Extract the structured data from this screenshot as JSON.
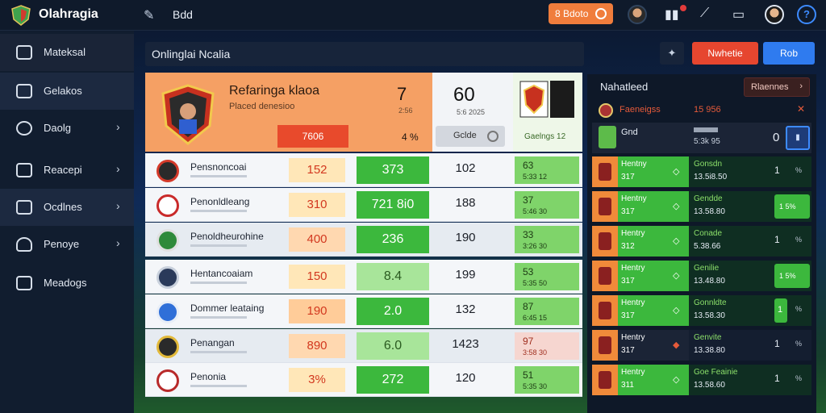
{
  "topbar": {
    "app_title": "Olahragia",
    "title2": "Bdd",
    "orange_button": "8 Bdoto"
  },
  "sidebar": {
    "items": [
      {
        "label": "Mateksal"
      },
      {
        "label": "Gelakos"
      },
      {
        "label": "Daolg"
      },
      {
        "label": "Reacepi"
      },
      {
        "label": "Ocdlnes"
      },
      {
        "label": "Penoye"
      },
      {
        "label": "Meadogs"
      }
    ]
  },
  "main": {
    "header_title": "Onlinglai Ncalia",
    "red_button": "Nwhetie",
    "blue_button": "Rob"
  },
  "featured": {
    "name": "Refaringa klaoa",
    "subtitle": "Placed denesioo",
    "number": "7",
    "number_sub": "2:56",
    "red_value": "7606",
    "pct": "4 %",
    "score": "60",
    "score_sub": "5:6 2025",
    "pill_label": "Gclde",
    "right_label": "Gaelngs 12"
  },
  "rows": [
    {
      "name": "Pensnoncoai",
      "v1": "152",
      "v2": "373",
      "v3": "102",
      "v4a": "63",
      "v4b": "5:33 12"
    },
    {
      "name": "Penonldleang",
      "v1": "310",
      "v2": "721 8i0",
      "v3": "188",
      "v4a": "37",
      "v4b": "5:46 30"
    },
    {
      "name": "Penoldheurohine",
      "v1": "400",
      "v2": "236",
      "v3": "190",
      "v4a": "33",
      "v4b": "3:26 30"
    },
    {
      "name": "Hentancoaiam",
      "v1": "150",
      "v2": "8.4",
      "v3": "199",
      "v4a": "53",
      "v4b": "5:35 50"
    },
    {
      "name": "Dommer leataing",
      "v1": "190",
      "v2": "2.0",
      "v3": "132",
      "v4a": "87",
      "v4b": "6:45 15"
    },
    {
      "name": "Penangan",
      "v1": "890",
      "v2": "6.0",
      "v3": "1423",
      "v4a": "97",
      "v4b": "3:58 30"
    },
    {
      "name": "Penonia",
      "v1": "3%",
      "v2": "272",
      "v3": "120",
      "v4a": "51",
      "v4b": "5:35 30"
    }
  ],
  "right_panel": {
    "title": "Nahatleed",
    "button": "Rlaennes",
    "header_label": "Faeneigss",
    "header_num": "15 956",
    "row0": {
      "label": "Gnd",
      "sub": "5:3k 95",
      "num": "0"
    },
    "rows": [
      {
        "name": "Hentny",
        "val": "317",
        "gl": "Gonsdn",
        "gv": "13.5i8.50",
        "right": "1",
        "mark": "%"
      },
      {
        "name": "Hentny",
        "val": "317",
        "gl": "Gendde",
        "gv": "13.58.80",
        "right": "1",
        "mark": "5%"
      },
      {
        "name": "Hentry",
        "val": "312",
        "gl": "Conade",
        "gv": "5.38.66",
        "right": "1",
        "mark": "%"
      },
      {
        "name": "Hentry",
        "val": "317",
        "gl": "Genilie",
        "gv": "13.48.80",
        "right": "1",
        "mark": "5%"
      },
      {
        "name": "Hentry",
        "val": "317",
        "gl": "Gonnldte",
        "gv": "13.58.30",
        "right": "1",
        "mark": "%"
      },
      {
        "name": "Hentry",
        "val": "317",
        "gl": "Genvite",
        "gv": "13.38.80",
        "right": "1",
        "mark": "%"
      },
      {
        "name": "Hentry",
        "val": "311",
        "gl": "Goe Feainie",
        "gv": "13.58.60",
        "right": "1",
        "mark": "%"
      }
    ]
  }
}
